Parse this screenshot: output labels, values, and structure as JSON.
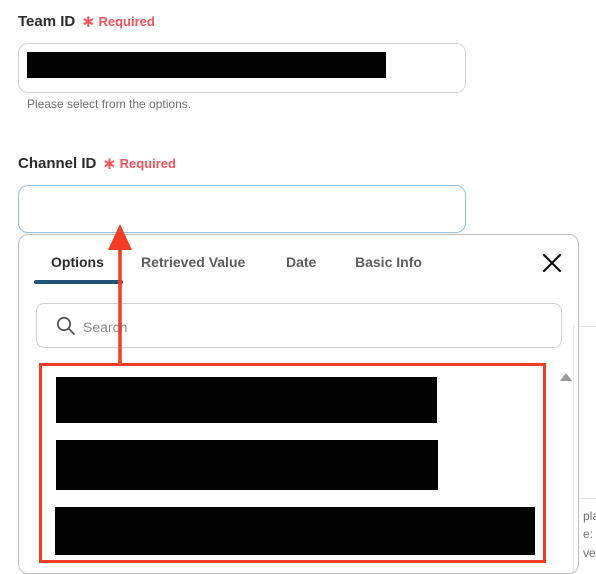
{
  "team_field": {
    "label": "Team ID",
    "required_label": "Required",
    "helper_text": "Please select from the options."
  },
  "channel_field": {
    "label": "Channel ID",
    "required_label": "Required",
    "value": ""
  },
  "dropdown": {
    "tabs": [
      {
        "label": "Options",
        "active": true
      },
      {
        "label": "Retrieved Value",
        "active": false
      },
      {
        "label": "Date",
        "active": false
      },
      {
        "label": "Basic Info",
        "active": false
      }
    ],
    "close_icon": "close-icon",
    "search": {
      "placeholder": "Search",
      "icon": "search-icon"
    }
  },
  "background_peek": [
    "play",
    "e:",
    "ve"
  ],
  "colors": {
    "required": "#f2545b",
    "tab_underline": "#20527a",
    "annotation": "#f23c26",
    "focus_border": "#8ec3ef"
  }
}
